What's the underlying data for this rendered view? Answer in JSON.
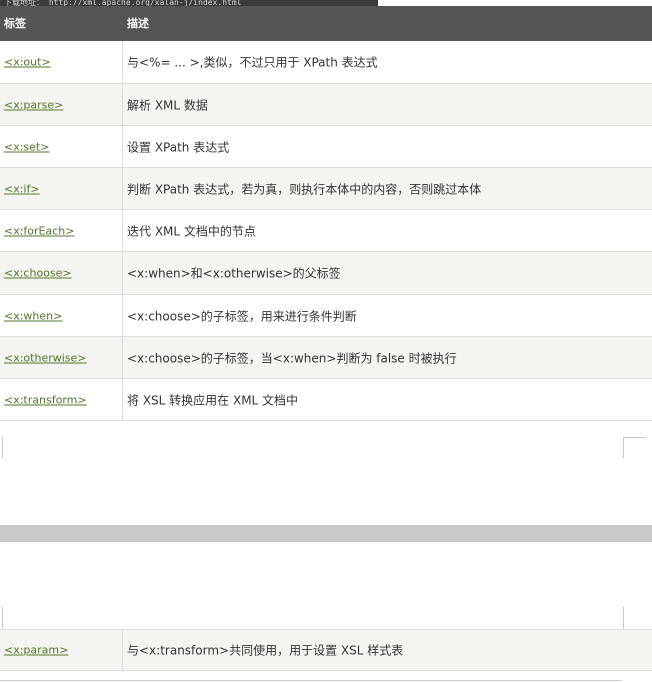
{
  "top_strip": "下载地址： http://xml.apache.org/xalan-j/index.html",
  "table": {
    "header": {
      "col1": "标签",
      "col2": "描述"
    },
    "rows": [
      {
        "tag": "<x:out>",
        "desc": "与<%= ... >,类似，不过只用于 XPath 表达式"
      },
      {
        "tag": "<x:parse>",
        "desc": "解析 XML 数据"
      },
      {
        "tag": "<x:set>",
        "desc": "设置 XPath 表达式"
      },
      {
        "tag": "<x:if>",
        "desc": "判断 XPath 表达式，若为真，则执行本体中的内容，否则跳过本体"
      },
      {
        "tag": "<x:forEach>",
        "desc": "迭代 XML 文档中的节点"
      },
      {
        "tag": "<x:choose>",
        "desc": "<x:when>和<x:otherwise>的父标签"
      },
      {
        "tag": "<x:when>",
        "desc": "<x:choose>的子标签，用来进行条件判断"
      },
      {
        "tag": "<x:otherwise>",
        "desc": "<x:choose>的子标签，当<x:when>判断为 false 时被执行"
      },
      {
        "tag": "<x:transform>",
        "desc": "将 XSL 转换应用在 XML 文档中"
      }
    ],
    "continued_rows": [
      {
        "tag": "<x:param>",
        "desc": "与<x:transform>共同使用，用于设置 XSL 样式表"
      }
    ]
  }
}
